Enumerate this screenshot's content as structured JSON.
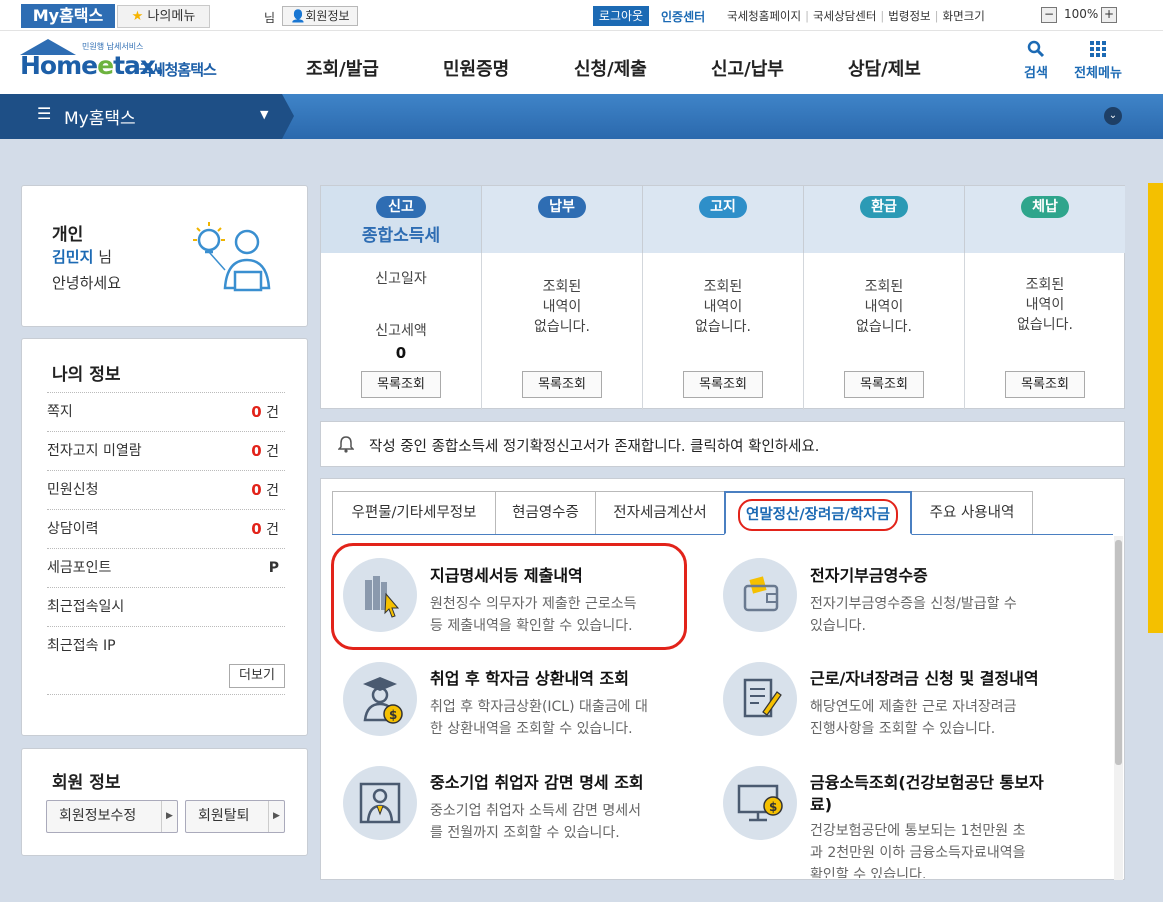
{
  "topbar": {
    "my_hometax": "My홈택스",
    "my_menu": "나의메뉴",
    "nim": "님",
    "member_info": "회원정보",
    "logout": "로그아웃",
    "cert_center": "인증센터",
    "links": [
      "국세청홈페이지",
      "국세상담센터",
      "법령정보",
      "화면크기"
    ],
    "zoom_minus": "−",
    "zoom_level": "100%",
    "zoom_plus": "+"
  },
  "header": {
    "logo_small": "민원행 납세서비스",
    "logo_home": "Home",
    "logo_e": "e",
    "logo_tax": "tax.",
    "logo_kr": "국세청홈택스",
    "menu": [
      "조회/발급",
      "민원증명",
      "신청/제출",
      "신고/납부",
      "상담/제보"
    ],
    "search": "검색",
    "all_menu": "전체메뉴"
  },
  "band": {
    "title": "My홈택스"
  },
  "personal": {
    "type": "개인",
    "name": "김민지",
    "suffix": "님",
    "greeting": "안녕하세요"
  },
  "my_info": {
    "title": "나의 정보",
    "rows": [
      {
        "label": "쪽지",
        "value": "0",
        "unit": "건"
      },
      {
        "label": "전자고지 미열람",
        "value": "0",
        "unit": "건"
      },
      {
        "label": "민원신청",
        "value": "0",
        "unit": "건"
      },
      {
        "label": "상담이력",
        "value": "0",
        "unit": "건"
      },
      {
        "label": "세금포인트",
        "value": "",
        "unit": "P"
      },
      {
        "label": "최근접속일시",
        "value": "",
        "unit": ""
      },
      {
        "label": "최근접속 IP",
        "value": "",
        "unit": ""
      }
    ],
    "more": "더보기"
  },
  "member": {
    "title": "회원 정보",
    "edit": "회원정보수정",
    "withdraw": "회원탈퇴"
  },
  "summary": {
    "columns": [
      {
        "badge": "신고",
        "color": "#2e6db3",
        "subtitle": "종합소득세"
      },
      {
        "badge": "납부",
        "color": "#2e6db3"
      },
      {
        "badge": "고지",
        "color": "#2e8fc9"
      },
      {
        "badge": "환급",
        "color": "#2b9ab5"
      },
      {
        "badge": "체납",
        "color": "#2ea58c"
      }
    ],
    "report_date_label": "신고일자",
    "report_amount_label": "신고세액",
    "report_amount": "0",
    "empty_line1": "조회된",
    "empty_line2": "내역이",
    "empty_line3": "없습니다.",
    "list_btn": "목록조회"
  },
  "notice": "작성 중인 종합소득세 정기확정신고서가 존재합니다. 클릭하여 확인하세요.",
  "tabs": [
    "우편물/기타세무정보",
    "현금영수증",
    "전자세금계산서",
    "연말정산/장려금/학자금",
    "주요 사용내역"
  ],
  "services": [
    {
      "title": "지급명세서등 제출내역",
      "desc1": "원천징수 의무자가 제출한 근로소득",
      "desc2": "등 제출내역을 확인할 수 있습니다.",
      "icon": "books-cursor-icon"
    },
    {
      "title": "전자기부금영수증",
      "desc1": "전자기부금영수증을 신청/발급할 수",
      "desc2": "있습니다.",
      "icon": "wallet-icon"
    },
    {
      "title": "취업 후 학자금 상환내역 조회",
      "desc1": "취업 후 학자금상환(ICL) 대출금에 대",
      "desc2": "한 상환내역을 조회할 수 있습니다.",
      "icon": "graduate-coin-icon"
    },
    {
      "title": "근로/자녀장려금 신청 및 결정내역",
      "desc1": "해당연도에 제출한 근로 자녀장려금",
      "desc2": "진행사항을 조회할 수 있습니다.",
      "icon": "document-pen-icon"
    },
    {
      "title": "중소기업 취업자 감면 명세 조회",
      "desc1": "중소기업 취업자 소득세 감면 명세서",
      "desc2": "를 전월까지 조회할 수 있습니다.",
      "icon": "worker-icon"
    },
    {
      "title": "금융소득조회(건강보험공단 통보자",
      "title2": "료)",
      "desc1": "건강보험공단에 통보되는 1천만원 초",
      "desc2": "과 2천만원 이하 금융소득자료내역을",
      "desc3": "확인할 수 있습니다.",
      "icon": "monitor-coin-icon"
    }
  ],
  "colors": {
    "accent": "#1c6ab4",
    "highlight_red": "#e2231a",
    "band": "#2b69ad"
  }
}
